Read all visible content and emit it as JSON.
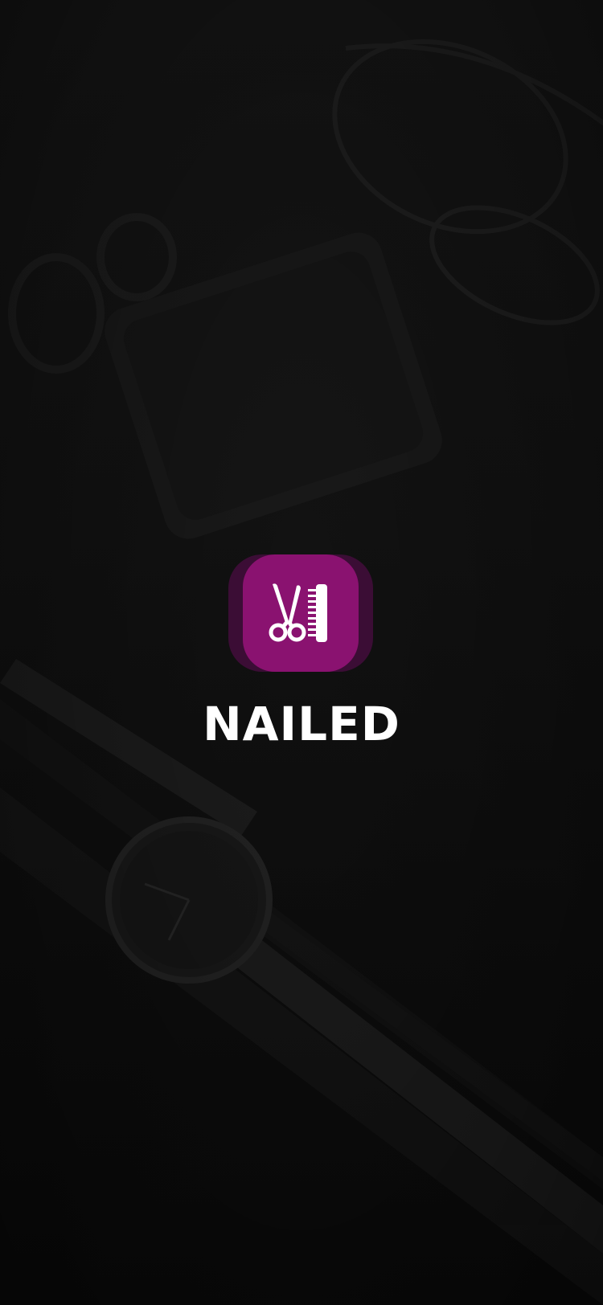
{
  "app": {
    "name": "NAILED"
  },
  "logo": {
    "icon": "scissors-comb-icon",
    "accent_color": "#8a1270",
    "shadow_color": "#3b0d35"
  },
  "background": {
    "description_icon": "flatlay-photo",
    "base_color": "#121212"
  }
}
